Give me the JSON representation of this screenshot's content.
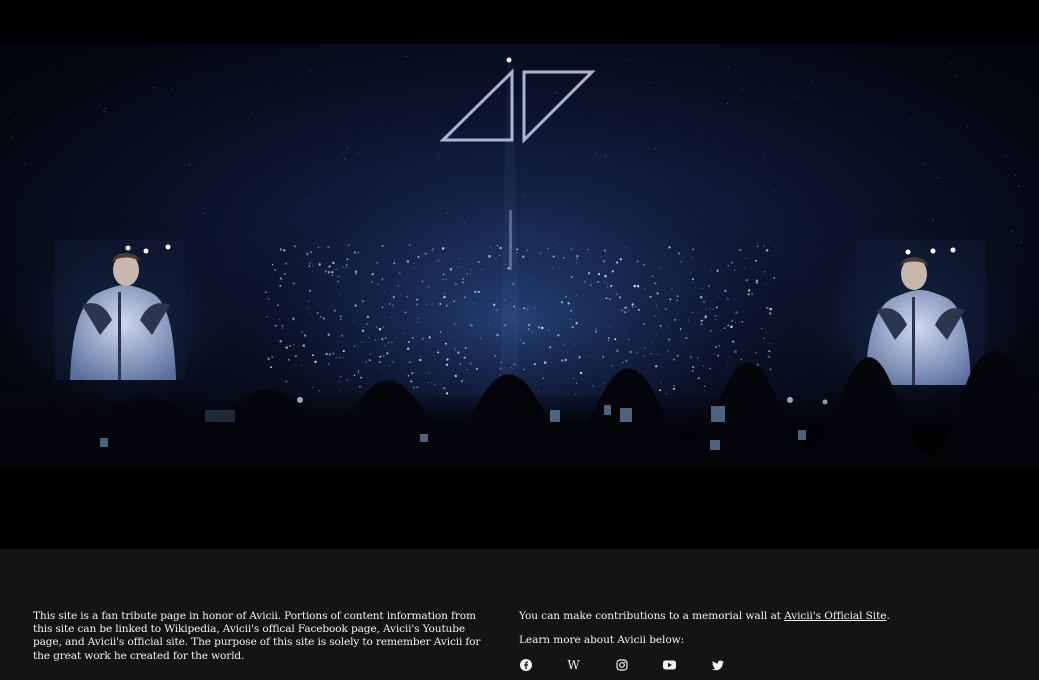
{
  "hero": {
    "image": "avicii-tribute-concert",
    "logo": "avicii-triangle-logo-icon"
  },
  "footer": {
    "tribute_text": "This site is a fan tribute page in honor of Avicii. Portions of content information from this site can be linked to Wikipedia, Avicii's offical Facebook page, Avicii's Youtube page, and Avicii's official site. The purpose of this site is solely to remember Avicii for the great work he created for the world.",
    "memorial_prefix": "You can make contributions to a memorial wall at ",
    "memorial_link": "Avicii's Official Site",
    "memorial_suffix": ".",
    "learn_more": "Learn more about Avicii below:",
    "socials": [
      {
        "name": "facebook",
        "icon": "facebook-icon"
      },
      {
        "name": "wikipedia",
        "icon": "wikipedia-icon"
      },
      {
        "name": "instagram",
        "icon": "instagram-icon"
      },
      {
        "name": "youtube",
        "icon": "youtube-icon"
      },
      {
        "name": "twitter",
        "icon": "twitter-icon"
      }
    ]
  },
  "colors": {
    "footer_bg": "#141414",
    "text": "#f1f1f1",
    "stage_glow": "#3a5fa8"
  }
}
